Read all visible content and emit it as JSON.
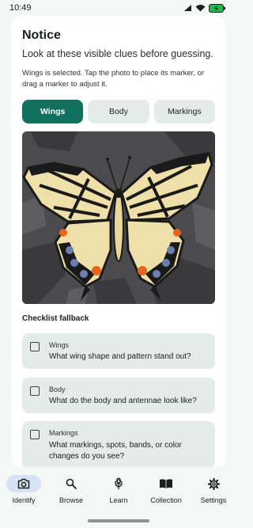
{
  "status": {
    "time": "10:49"
  },
  "notice": {
    "title": "Notice",
    "subtitle": "Look at these visible clues before guessing.",
    "helper": "Wings is selected. Tap the photo to place its marker, or drag a marker to adjust it."
  },
  "tabs": [
    {
      "label": "Wings",
      "selected": true
    },
    {
      "label": "Body",
      "selected": false
    },
    {
      "label": "Markings",
      "selected": false
    }
  ],
  "photo": {
    "subject": "swallowtail butterfly on dark rocks"
  },
  "checklist": {
    "title": "Checklist fallback",
    "items": [
      {
        "label": "Wings",
        "question": "What wing shape and pattern stand out?",
        "checked": false
      },
      {
        "label": "Body",
        "question": "What do the body and antennae look like?",
        "checked": false
      },
      {
        "label": "Markings",
        "question": "What markings, spots, bands, or color changes do you see?",
        "checked": false
      }
    ]
  },
  "nav": [
    {
      "label": "Identify",
      "icon": "camera-icon",
      "active": true
    },
    {
      "label": "Browse",
      "icon": "search-icon",
      "active": false
    },
    {
      "label": "Learn",
      "icon": "flower-icon",
      "active": false
    },
    {
      "label": "Collection",
      "icon": "book-icon",
      "active": false
    },
    {
      "label": "Settings",
      "icon": "gear-icon",
      "active": false
    }
  ],
  "colors": {
    "accent": "#12705f",
    "surface": "#e4ebe8",
    "nav_active": "#d7e3f4",
    "battery": "#1fb84c"
  }
}
